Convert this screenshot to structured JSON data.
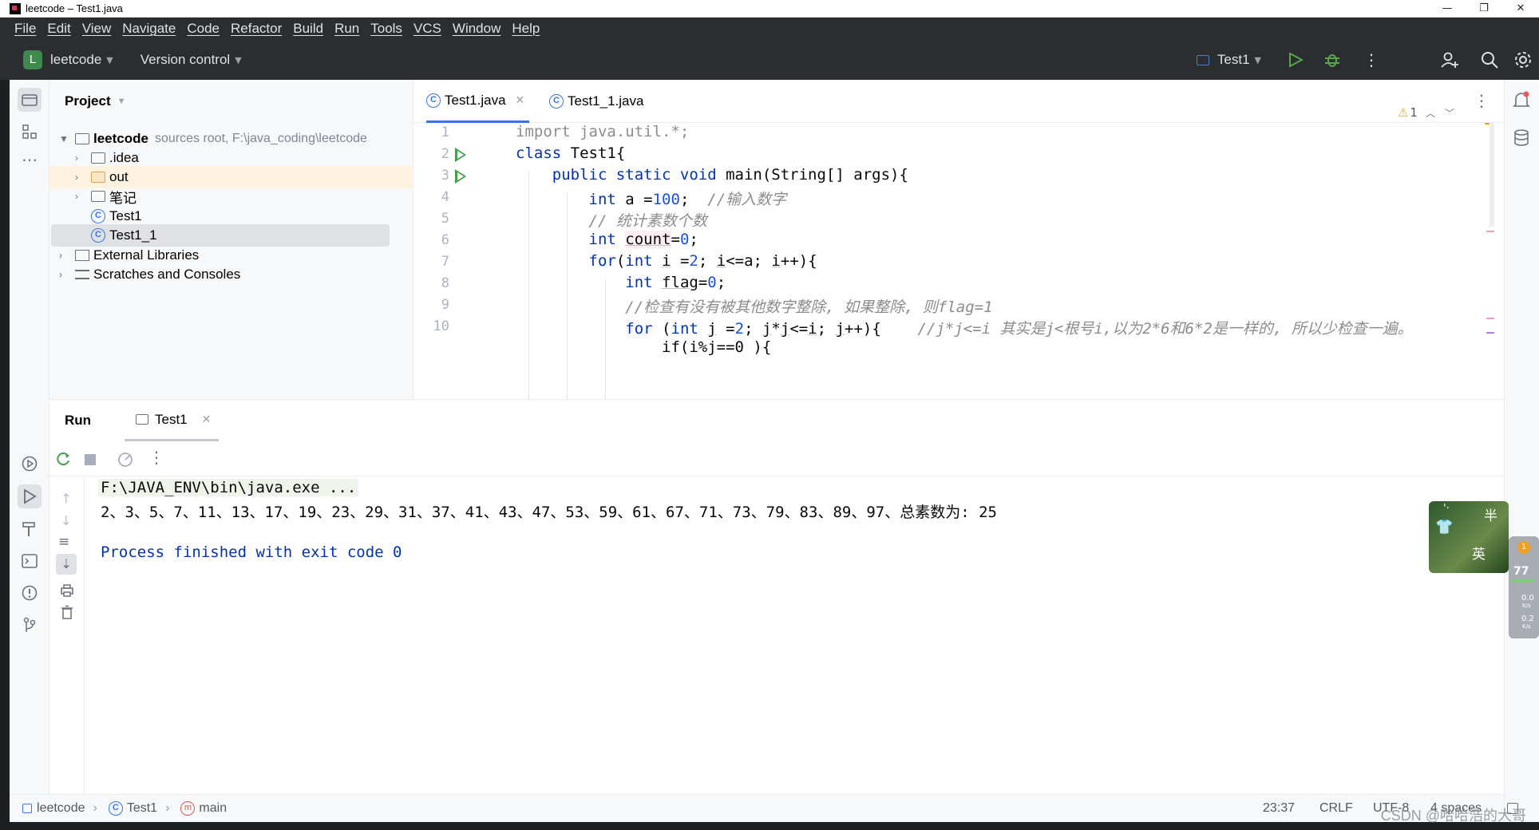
{
  "window": {
    "title": "leetcode – Test1.java",
    "controls": [
      "—",
      "❐",
      "✕"
    ]
  },
  "menu": [
    "File",
    "Edit",
    "View",
    "Navigate",
    "Code",
    "Refactor",
    "Build",
    "Run",
    "Tools",
    "VCS",
    "Window",
    "Help"
  ],
  "toolbar": {
    "project_badge": "L",
    "project_name": "leetcode",
    "vcs_label": "Version control",
    "run_config": "Test1"
  },
  "project_panel": {
    "title": "Project",
    "root": {
      "name": "leetcode",
      "hint": "sources root,  F:\\java_coding\\leetcode"
    },
    "items": [
      ".idea",
      "out",
      "笔记",
      "Test1",
      "Test1_1"
    ],
    "external": "External Libraries",
    "scratches": "Scratches and Consoles"
  },
  "editor": {
    "tabs": [
      {
        "label": "Test1.java",
        "icon": "C"
      },
      {
        "label": "Test1_1.java",
        "icon": "C"
      }
    ],
    "warning_count": "1",
    "line_numbers": [
      "1",
      "2",
      "3",
      "4",
      "5",
      "6",
      "7",
      "8",
      "9",
      "10"
    ]
  },
  "run_panel": {
    "title": "Run",
    "tab": "Test1",
    "console": {
      "cmd": "F:\\JAVA_ENV\\bin\\java.exe ...",
      "output": "2、3、5、7、11、13、17、19、23、29、31、37、41、43、47、53、59、61、67、71、73、79、83、89、97、总素数为: 25",
      "exit": "Process finished with exit code 0"
    }
  },
  "statusbar": {
    "crumbs": [
      "leetcode",
      "Test1",
      "main"
    ],
    "position": "23:37",
    "line_sep": "CRLF",
    "encoding": "UTF-8",
    "indent": "4 spaces"
  },
  "ime": {
    "top_right": "半",
    "bottom": "英"
  },
  "net": {
    "cpu": "77",
    "up": "0.0",
    "down": "0.2",
    "unit": "K/s",
    "badge": "1"
  },
  "watermark": "CSDN @哈哈浩的大哥",
  "colors": {
    "keyword": "#0033b3",
    "number": "#1750eb",
    "comment": "#8c8c8c",
    "run_green": "#41a047",
    "accent": "#3574f0"
  }
}
